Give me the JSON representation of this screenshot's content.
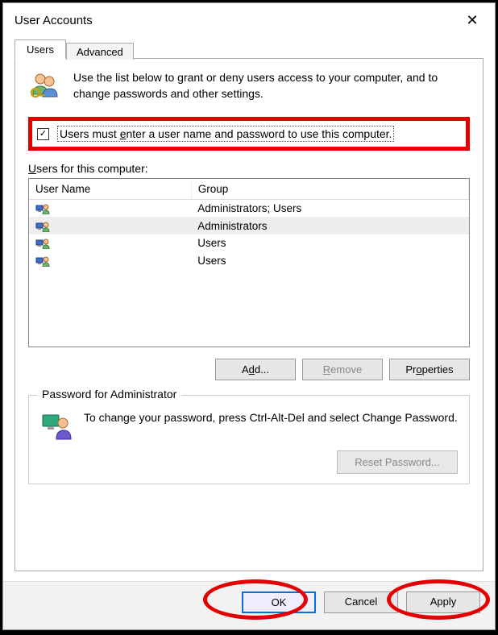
{
  "window": {
    "title": "User Accounts"
  },
  "tabs": {
    "users": "Users",
    "advanced": "Advanced"
  },
  "intro": {
    "text": "Use the list below to grant or deny users access to your computer, and to change passwords and other settings."
  },
  "checkbox": {
    "checked": true,
    "label_pre": "Users must ",
    "label_underline": "e",
    "label_post": "nter a user name and password to use this computer."
  },
  "userlist": {
    "label_underline": "U",
    "label_post": "sers for this computer:",
    "columns": {
      "name": "User Name",
      "group": "Group"
    },
    "rows": [
      {
        "name": "",
        "group": "Administrators; Users",
        "selected": false
      },
      {
        "name": "",
        "group": "Administrators",
        "selected": true
      },
      {
        "name": "",
        "group": "Users",
        "selected": false
      },
      {
        "name": "",
        "group": "Users",
        "selected": false
      }
    ]
  },
  "buttons": {
    "add_pre": "A",
    "add_u": "d",
    "add_post": "d...",
    "remove_u": "R",
    "remove_post": "emove",
    "properties_pre": "Pr",
    "properties_u": "o",
    "properties_post": "perties"
  },
  "password_group": {
    "title": "Password for Administrator",
    "text": "To change your password, press Ctrl-Alt-Del and select Change Password.",
    "reset_pre": "Reset ",
    "reset_u": "P",
    "reset_post": "assword..."
  },
  "footer": {
    "ok": "OK",
    "cancel": "Cancel",
    "apply_u": "A",
    "apply_post": "pply"
  }
}
